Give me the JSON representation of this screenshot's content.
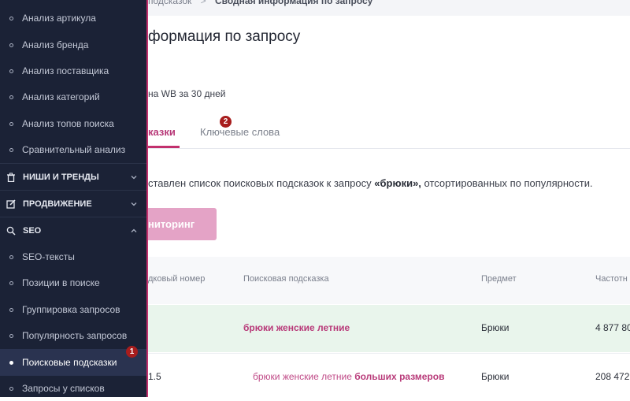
{
  "sidebar": {
    "items_top": [
      {
        "label": "Анализ артикула"
      },
      {
        "label": "Анализ бренда"
      },
      {
        "label": "Анализ поставщика"
      },
      {
        "label": "Анализ категорий"
      },
      {
        "label": "Анализ топов поиска"
      },
      {
        "label": "Сравнительный анализ"
      }
    ],
    "sections": {
      "niches": "НИШИ И ТРЕНДЫ",
      "promotion": "ПРОДВИЖЕНИЕ",
      "seo": "SEO"
    },
    "seo_items": [
      {
        "label": "SEO-тексты"
      },
      {
        "label": "Позиции в поиске"
      },
      {
        "label": "Группировка запросов"
      },
      {
        "label": "Популярность запросов"
      },
      {
        "label": "Поисковые подсказки"
      },
      {
        "label": "Запросы у списков"
      }
    ],
    "badge": "1"
  },
  "breadcrumb": {
    "parent": "подсказок",
    "separator": ">",
    "current": "Сводная информация по запросу"
  },
  "page_title": "формация по запросу",
  "subtitle": "на WB за 30 дней",
  "tabs": {
    "active": "казки",
    "second": "Ключевые слова",
    "badge": "2"
  },
  "description": {
    "before": "ставлен список поисковых подсказок к запросу ",
    "query": "«брюки»,",
    "after": " отсортированных по популярности."
  },
  "monitor_button": "ниторинг",
  "table": {
    "headers": [
      "дковый номер",
      "Поисковая подсказка",
      "Предмет",
      "Частотн"
    ],
    "rows": [
      {
        "num": "",
        "hint": "брюки женские летние",
        "subject": "Брюки",
        "freq": "4 877 80"
      },
      {
        "num": "1.5",
        "hint_plain": "брюки женские летние ",
        "hint_bold": "больших размеров",
        "subject": "Брюки",
        "freq": "208 472"
      }
    ]
  },
  "colors": {
    "sidebar_bg": "#1b2236",
    "accent": "#c2306d",
    "link": "#b83a79",
    "button": "#e4a3c6",
    "row_highlight": "#e9f5ec",
    "badge": "#a81d1d"
  }
}
